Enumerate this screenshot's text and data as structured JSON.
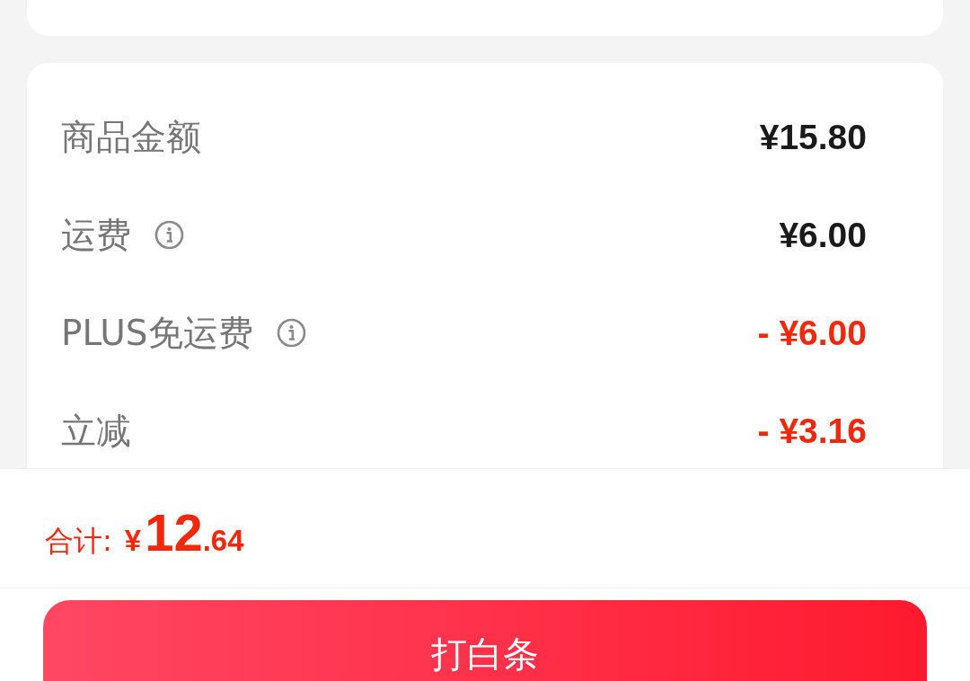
{
  "price_details": {
    "rows": [
      {
        "label": "商品金额",
        "info": false,
        "kind": "charge",
        "value": "¥15.80"
      },
      {
        "label": "运费",
        "info": true,
        "kind": "charge",
        "value": "¥6.00"
      },
      {
        "label": "PLUS免运费",
        "info": true,
        "kind": "discount",
        "value": "- ¥6.00"
      },
      {
        "label": "立减",
        "info": false,
        "kind": "discount",
        "value": "- ¥3.16"
      }
    ]
  },
  "footer": {
    "total_label": "合计:",
    "currency": "¥",
    "total_integer": "12",
    "total_decimal": ".64",
    "button": "打白条"
  }
}
